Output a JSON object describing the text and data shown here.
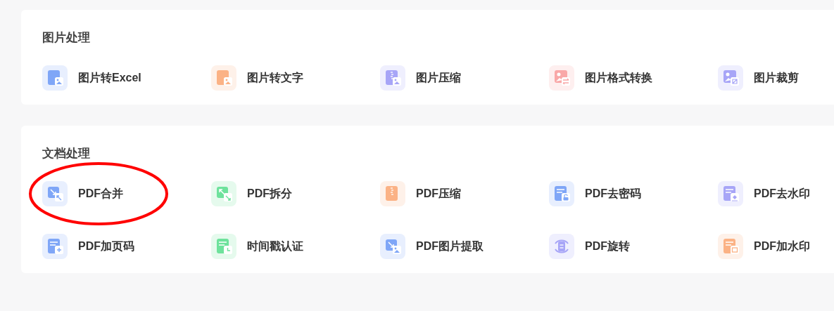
{
  "sections": [
    {
      "title": "图片处理",
      "items": [
        {
          "label": "图片转Excel",
          "color": "#7fa6f7",
          "kind": "excel",
          "circled": false
        },
        {
          "label": "图片转文字",
          "color": "#fbb285",
          "kind": "text",
          "circled": false
        },
        {
          "label": "图片压缩",
          "color": "#a7a5f7",
          "kind": "shrink",
          "circled": false
        },
        {
          "label": "图片格式转换",
          "color": "#f9a8a8",
          "kind": "convert",
          "circled": false
        },
        {
          "label": "图片裁剪",
          "color": "#a7a5f7",
          "kind": "crop",
          "circled": false
        }
      ]
    },
    {
      "title": "文档处理",
      "items": [
        {
          "label": "PDF合并",
          "color": "#7fa6f7",
          "kind": "merge",
          "circled": true
        },
        {
          "label": "PDF拆分",
          "color": "#6ee29c",
          "kind": "split",
          "circled": false
        },
        {
          "label": "PDF压缩",
          "color": "#fbb285",
          "kind": "compress",
          "circled": false
        },
        {
          "label": "PDF去密码",
          "color": "#7fa6f7",
          "kind": "unlock",
          "circled": false
        },
        {
          "label": "PDF去水印",
          "color": "#a7a5f7",
          "kind": "unwatermark",
          "circled": false
        },
        {
          "label": "PDF加页码",
          "color": "#7fa6f7",
          "kind": "pagenum",
          "circled": false
        },
        {
          "label": "时间戳认证",
          "color": "#6ee29c",
          "kind": "timestamp",
          "circled": false
        },
        {
          "label": "PDF图片提取",
          "color": "#7fa6f7",
          "kind": "extract",
          "circled": false
        },
        {
          "label": "PDF旋转",
          "color": "#a7a5f7",
          "kind": "rotate",
          "circled": false
        },
        {
          "label": "PDF加水印",
          "color": "#fbb285",
          "kind": "watermark",
          "circled": false
        }
      ]
    }
  ]
}
